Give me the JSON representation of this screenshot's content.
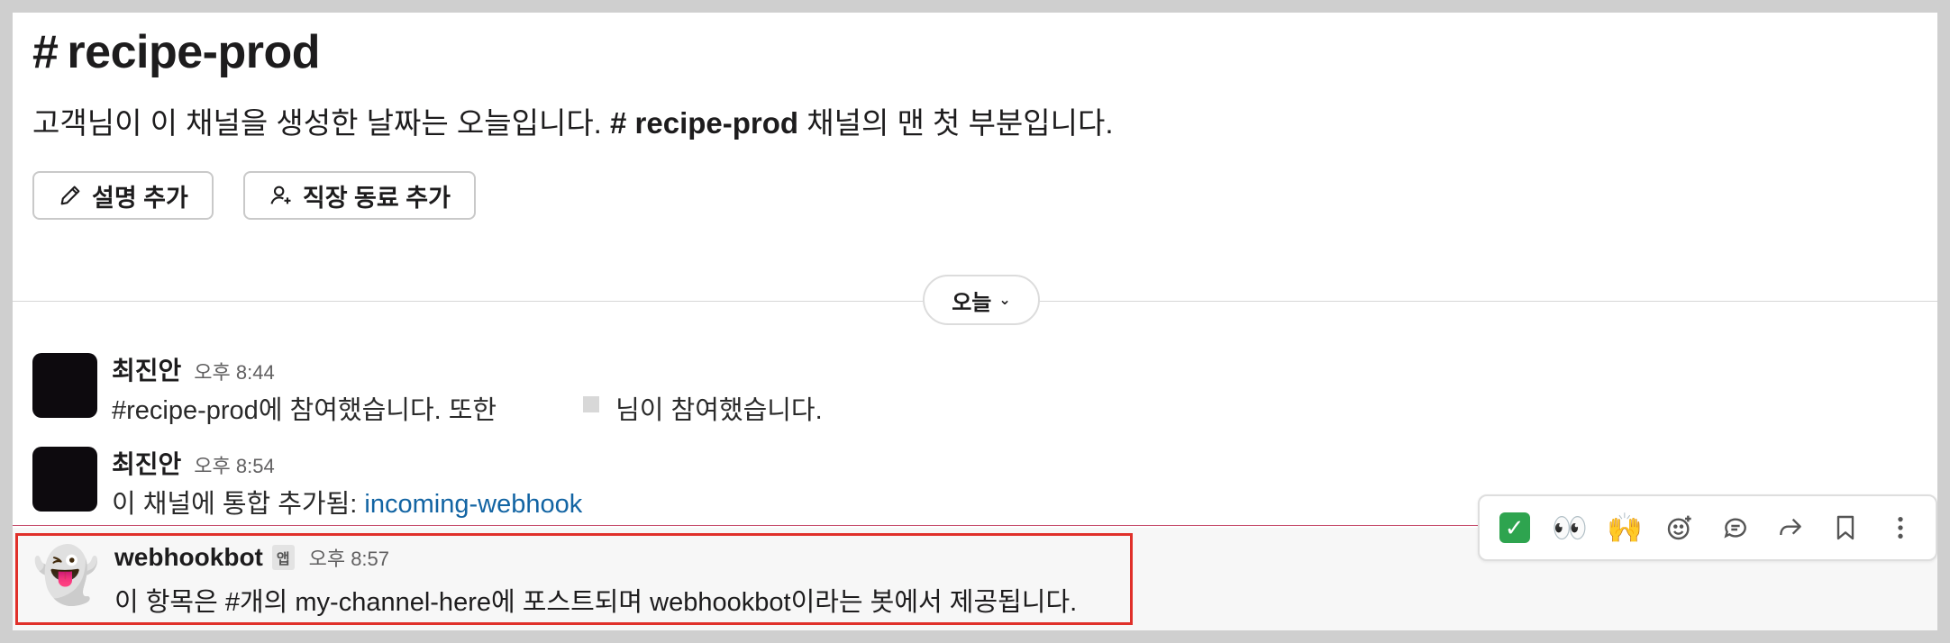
{
  "channel": {
    "hash": "#",
    "name": "recipe-prod",
    "intro_prefix": "고객님이 이 채널을 생성한 날짜는 오늘입니다.",
    "intro_channel": "# recipe-prod",
    "intro_suffix": "채널의 맨 첫 부분입니다."
  },
  "actions": {
    "add_description": "설명 추가",
    "add_coworkers": "직장 동료 추가"
  },
  "date_divider": {
    "label": "오늘"
  },
  "messages": [
    {
      "author": "최진안",
      "time": "오후 8:44",
      "text_prefix": "#recipe-prod에 참여했습니다. 또한",
      "text_suffix": "님이 참여했습니다."
    },
    {
      "author": "최진안",
      "time": "오후 8:54",
      "text_prefix": "이 채널에 통합 추가됨:",
      "link": "incoming-webhook"
    },
    {
      "author": "webhookbot",
      "badge": "앱",
      "time": "오후 8:57",
      "avatar": "👻",
      "text": "이 항목은 #개의 my-channel-here에 포스트되며 webhookbot이라는 봇에서 제공됩니다."
    }
  ],
  "toolbar": {
    "icons": [
      "white-check-mark-icon",
      "eyes-icon",
      "raised-hands-icon",
      "add-reaction-icon",
      "reply-in-thread-icon",
      "share-icon",
      "bookmark-icon",
      "more-actions-icon"
    ],
    "emoji_eyes": "👀",
    "emoji_hands": "🙌",
    "check": "✓"
  },
  "colors": {
    "link": "#1264a3",
    "highlight_border": "#e0302a",
    "new_messages_line": "#c64a6a",
    "check_green": "#2ea44f"
  }
}
